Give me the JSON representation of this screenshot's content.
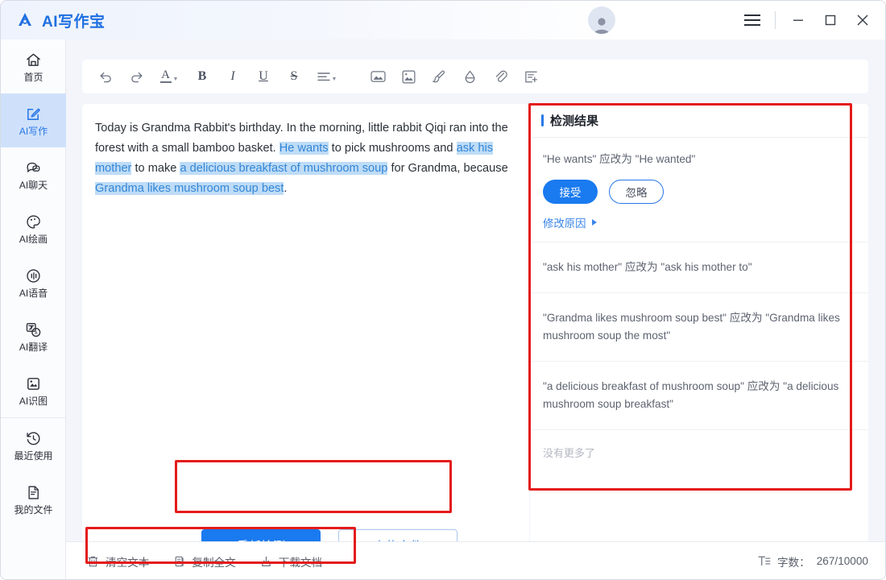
{
  "titlebar": {
    "app_name": "AI写作宝",
    "logo_icon": "triangle-a-logo",
    "avatar_icon": "user-avatar",
    "menu_icon": "hamburger-menu-icon",
    "minimize_label": "–",
    "maximize_label": "□",
    "close_label": "✕",
    "accent_color": "#1E6FE0"
  },
  "sidebar": {
    "items": [
      {
        "label": "首页",
        "icon": "home-icon",
        "active": false
      },
      {
        "label": "AI写作",
        "icon": "edit-square-icon",
        "active": true
      },
      {
        "label": "AI聊天",
        "icon": "chat-bubble-icon",
        "active": false
      },
      {
        "label": "AI绘画",
        "icon": "palette-icon",
        "active": false
      },
      {
        "label": "AI语音",
        "icon": "voice-wave-icon",
        "active": false
      },
      {
        "label": "AI翻译",
        "icon": "translate-icon",
        "active": false
      },
      {
        "label": "AI识图",
        "icon": "image-scan-icon",
        "active": false
      },
      {
        "label": "最近使用",
        "icon": "history-clock-icon",
        "active": false
      },
      {
        "label": "我的文件",
        "icon": "document-icon",
        "active": false
      }
    ],
    "active_bg": "#cfe1fa",
    "active_fg": "#2878E8"
  },
  "toolbar": {
    "items": [
      {
        "name": "undo",
        "glyph": "↶",
        "caret": false
      },
      {
        "name": "redo",
        "glyph": "↷",
        "caret": false
      },
      {
        "name": "font-color",
        "glyph": "A",
        "caret": true
      },
      {
        "name": "bold",
        "glyph": "B",
        "caret": false
      },
      {
        "name": "italic",
        "glyph": "I",
        "caret": false
      },
      {
        "name": "underline",
        "glyph": "U",
        "caret": false
      },
      {
        "name": "strikethrough",
        "glyph": "S",
        "caret": false
      },
      {
        "name": "align",
        "glyph": "≡",
        "caret": true
      },
      {
        "name": "insert-image",
        "glyph": "image",
        "caret": false
      },
      {
        "name": "image-frame",
        "glyph": "image-frame",
        "caret": false
      },
      {
        "name": "brush",
        "glyph": "brush",
        "caret": false
      },
      {
        "name": "eraser",
        "glyph": "eraser",
        "caret": false
      },
      {
        "name": "attachment",
        "glyph": "paperclip",
        "caret": false
      },
      {
        "name": "insert-form",
        "glyph": "form",
        "caret": false
      }
    ]
  },
  "editor": {
    "segments": [
      {
        "text": "  Today is Grandma Rabbit's birthday. In the morning, little rabbit Qiqi ran into the forest with a small bamboo basket. ",
        "highlight": false
      },
      {
        "text": "He wants",
        "highlight": true
      },
      {
        "text": " to pick mushrooms and ",
        "highlight": false
      },
      {
        "text": "ask his mother",
        "highlight": true
      },
      {
        "text": " to make ",
        "highlight": false
      },
      {
        "text": "a delicious breakfast of mushroom soup",
        "highlight": true
      },
      {
        "text": " for Grandma, because ",
        "highlight": false
      },
      {
        "text": "Grandma likes mushroom soup best",
        "highlight": true
      },
      {
        "text": ".",
        "highlight": false
      }
    ],
    "highlight_bg": "#bedcf6",
    "highlight_fg": "#3385d6"
  },
  "actions": {
    "redetect_label": "重新检测",
    "upload_label": "上传文件"
  },
  "results": {
    "title": "检测结果",
    "items": [
      {
        "text": "\"He wants\" 应改为 \"He wanted\"",
        "accept_label": "接受",
        "ignore_label": "忽略",
        "reason_label": "修改原因",
        "expanded": true
      },
      {
        "text": "\"ask his mother\" 应改为 \"ask his mother to\"",
        "expanded": false
      },
      {
        "text": "\"Grandma likes mushroom soup best\" 应改为 \"Grandma likes mushroom soup the most\"",
        "expanded": false
      },
      {
        "text": "\"a delicious breakfast of mushroom soup\" 应改为 \"a delicious mushroom soup breakfast\"",
        "expanded": false
      }
    ],
    "end_text": "没有更多了"
  },
  "bottombar": {
    "actions": [
      {
        "label": "清空文本",
        "icon": "trash-icon"
      },
      {
        "label": "复制全文",
        "icon": "copy-icon"
      },
      {
        "label": "下载文档",
        "icon": "download-icon"
      }
    ],
    "word_count_icon": "text-count-icon",
    "word_count_label": "字数：",
    "word_count_value": "267/10000"
  },
  "annotations": {
    "highlight_color": "#e41b1b",
    "boxes": [
      "results-panel",
      "action-buttons",
      "bottom-actions"
    ]
  }
}
